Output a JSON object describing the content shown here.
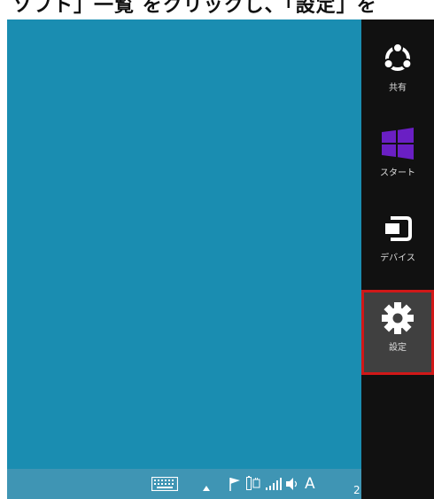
{
  "header": {
    "cropped_text": "ソフト」一覧 をクリックし、「設定」を"
  },
  "charms": [
    {
      "label": "共有",
      "icon": "share-icon"
    },
    {
      "label": "スタート",
      "icon": "windows-logo-icon"
    },
    {
      "label": "デバイス",
      "icon": "devices-icon"
    },
    {
      "label": "設定",
      "icon": "gear-icon",
      "selected": true
    }
  ],
  "taskbar": {
    "ime_label": "A",
    "clock_fragment": "2"
  },
  "colors": {
    "desktop": "#1a8db1",
    "taskbar": "#3f95b4",
    "charms_bar": "#111111",
    "highlight": "#d01818"
  }
}
